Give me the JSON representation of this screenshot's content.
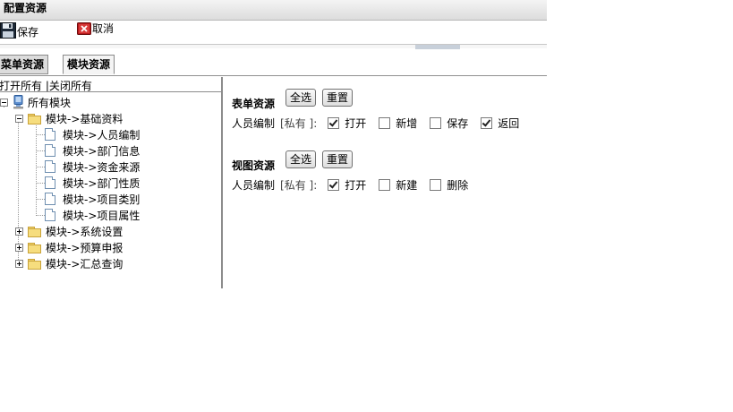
{
  "window": {
    "title": "配置资源"
  },
  "toolbar": {
    "save_label": "保存",
    "cancel_label": "取消"
  },
  "tabs": [
    {
      "label": "菜单资源",
      "active": false
    },
    {
      "label": "模块资源",
      "active": true
    }
  ],
  "tree": {
    "open_all": "打开所有",
    "divider": "|",
    "close_all": "关闭所有",
    "root": "所有模块",
    "groups": [
      {
        "label": "模块->基础资料",
        "expanded": true,
        "children": [
          "模块->人员编制",
          "模块->部门信息",
          "模块->资金来源",
          "模块->部门性质",
          "模块->项目类别",
          "模块->项目属性"
        ]
      },
      {
        "label": "模块->系统设置",
        "expanded": false
      },
      {
        "label": "模块->预算申报",
        "expanded": false
      },
      {
        "label": "模块->汇总查询",
        "expanded": false
      }
    ]
  },
  "form_resources": {
    "heading": "表单资源",
    "select_all": "全选",
    "reset": "重置",
    "row": {
      "name": "人员编制",
      "owner": "[私有 ]:",
      "perms": [
        {
          "label": "打开",
          "checked": true
        },
        {
          "label": "新增",
          "checked": false
        },
        {
          "label": "保存",
          "checked": false
        },
        {
          "label": "返回",
          "checked": true
        }
      ]
    }
  },
  "view_resources": {
    "heading": "视图资源",
    "select_all": "全选",
    "reset": "重置",
    "row": {
      "name": "人员编制",
      "owner": "[私有 ]:",
      "perms": [
        {
          "label": "打开",
          "checked": true
        },
        {
          "label": "新建",
          "checked": false
        },
        {
          "label": "删除",
          "checked": false
        }
      ]
    }
  },
  "colors": {
    "title_bar": "#dcdcdc",
    "folder": "#f6dd7e",
    "border": "#8c8c8c"
  },
  "icons": {
    "save": "floppy-disk-icon",
    "cancel": "cancel-icon",
    "root": "computer-icon",
    "folder": "folder-icon",
    "leaf": "page-icon"
  }
}
